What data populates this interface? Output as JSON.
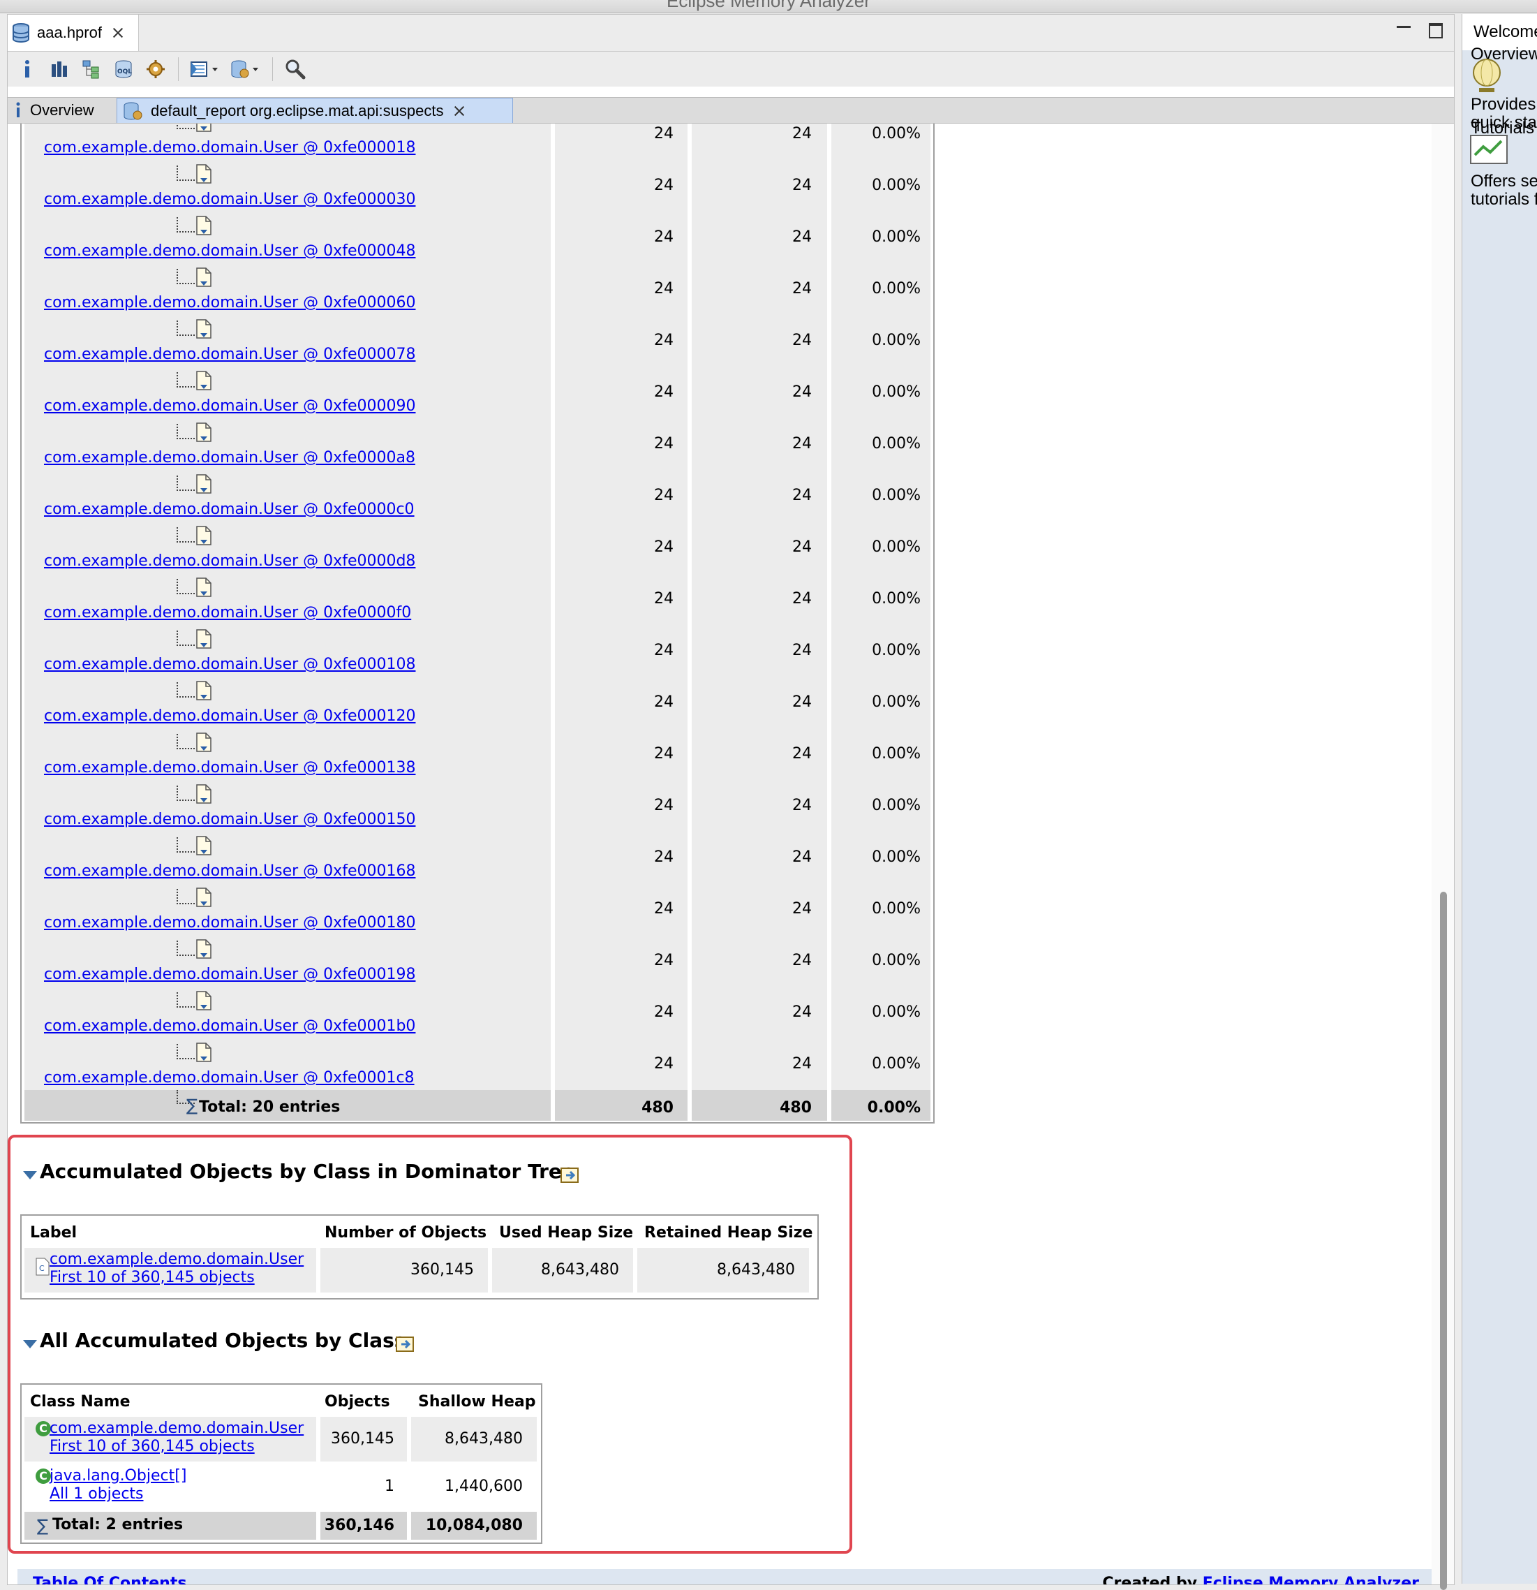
{
  "window": {
    "title": "Eclipse Memory Analyzer"
  },
  "editor": {
    "tab_label": "aaa.hprof",
    "subtabs": {
      "overview": "Overview",
      "report": "default_report  org.eclipse.mat.api:suspects"
    }
  },
  "object_table": {
    "rows": [
      {
        "label": "com.example.demo.domain.User @ 0xfe000018",
        "shallow": "24",
        "retained": "24",
        "percent": "0.00%"
      },
      {
        "label": "com.example.demo.domain.User @ 0xfe000030",
        "shallow": "24",
        "retained": "24",
        "percent": "0.00%"
      },
      {
        "label": "com.example.demo.domain.User @ 0xfe000048",
        "shallow": "24",
        "retained": "24",
        "percent": "0.00%"
      },
      {
        "label": "com.example.demo.domain.User @ 0xfe000060",
        "shallow": "24",
        "retained": "24",
        "percent": "0.00%"
      },
      {
        "label": "com.example.demo.domain.User @ 0xfe000078",
        "shallow": "24",
        "retained": "24",
        "percent": "0.00%"
      },
      {
        "label": "com.example.demo.domain.User @ 0xfe000090",
        "shallow": "24",
        "retained": "24",
        "percent": "0.00%"
      },
      {
        "label": "com.example.demo.domain.User @ 0xfe0000a8",
        "shallow": "24",
        "retained": "24",
        "percent": "0.00%"
      },
      {
        "label": "com.example.demo.domain.User @ 0xfe0000c0",
        "shallow": "24",
        "retained": "24",
        "percent": "0.00%"
      },
      {
        "label": "com.example.demo.domain.User @ 0xfe0000d8",
        "shallow": "24",
        "retained": "24",
        "percent": "0.00%"
      },
      {
        "label": "com.example.demo.domain.User @ 0xfe0000f0",
        "shallow": "24",
        "retained": "24",
        "percent": "0.00%"
      },
      {
        "label": "com.example.demo.domain.User @ 0xfe000108",
        "shallow": "24",
        "retained": "24",
        "percent": "0.00%"
      },
      {
        "label": "com.example.demo.domain.User @ 0xfe000120",
        "shallow": "24",
        "retained": "24",
        "percent": "0.00%"
      },
      {
        "label": "com.example.demo.domain.User @ 0xfe000138",
        "shallow": "24",
        "retained": "24",
        "percent": "0.00%"
      },
      {
        "label": "com.example.demo.domain.User @ 0xfe000150",
        "shallow": "24",
        "retained": "24",
        "percent": "0.00%"
      },
      {
        "label": "com.example.demo.domain.User @ 0xfe000168",
        "shallow": "24",
        "retained": "24",
        "percent": "0.00%"
      },
      {
        "label": "com.example.demo.domain.User @ 0xfe000180",
        "shallow": "24",
        "retained": "24",
        "percent": "0.00%"
      },
      {
        "label": "com.example.demo.domain.User @ 0xfe000198",
        "shallow": "24",
        "retained": "24",
        "percent": "0.00%"
      },
      {
        "label": "com.example.demo.domain.User @ 0xfe0001b0",
        "shallow": "24",
        "retained": "24",
        "percent": "0.00%"
      },
      {
        "label": "com.example.demo.domain.User @ 0xfe0001c8",
        "shallow": "24",
        "retained": "24",
        "percent": "0.00%"
      }
    ],
    "total": {
      "label": "Total: 20 entries",
      "shallow": "480",
      "retained": "480",
      "percent": "0.00%"
    }
  },
  "dominator_section": {
    "title": "Accumulated Objects by Class in Dominator Tree",
    "headers": [
      "Label",
      "Number of Objects",
      "Used Heap Size",
      "Retained Heap Size"
    ],
    "row": {
      "class": "com.example.demo.domain.User",
      "sub": "First 10 of 360,145 objects",
      "objects": "360,145",
      "used": "8,643,480",
      "retained": "8,643,480"
    }
  },
  "all_section": {
    "title": "All Accumulated Objects by Class",
    "headers": [
      "Class Name",
      "Objects",
      "Shallow Heap"
    ],
    "rows": [
      {
        "class": "com.example.demo.domain.User",
        "sub": "First 10 of 360,145 objects",
        "objects": "360,145",
        "shallow": "8,643,480"
      },
      {
        "class": "java.lang.Object[]",
        "sub": "All 1 objects",
        "objects": "1",
        "shallow": "1,440,600"
      }
    ],
    "total": {
      "label": "Total: 2 entries",
      "objects": "360,146",
      "shallow": "10,084,080"
    }
  },
  "footer": {
    "toc": "Table Of Contents",
    "created_prefix": "Created by ",
    "created_link": "Eclipse Memory Analyzer"
  },
  "welcome_panel": {
    "tab_label": "Welcome",
    "lines": [
      "Overview",
      "Provides",
      "quick sta",
      "Tutorials",
      "Offers se",
      "tutorials f"
    ]
  },
  "colors": {
    "link": "#0000ee",
    "highlight": "#e0454f",
    "row_bg": "#ececec",
    "total_bg": "#d4d4d4"
  }
}
